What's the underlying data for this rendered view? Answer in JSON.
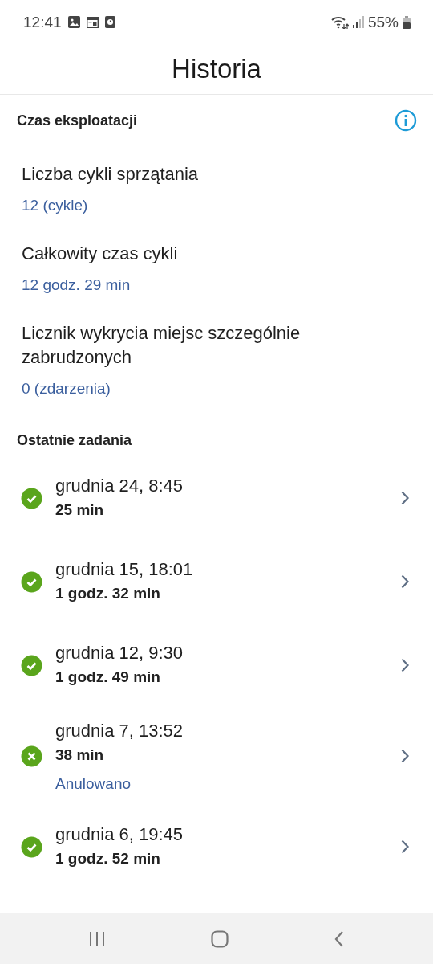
{
  "status_bar": {
    "time": "12:41",
    "battery": "55%"
  },
  "title": "Historia",
  "usage": {
    "heading": "Czas eksploatacji",
    "stats": [
      {
        "label": "Liczba cykli sprzątania",
        "value": "12 (cykle)"
      },
      {
        "label": "Całkowity czas cykli",
        "value": "12 godz. 29 min"
      },
      {
        "label": "Licznik wykrycia miejsc szczególnie zabrudzonych",
        "value": "0 (zdarzenia)"
      }
    ]
  },
  "recent": {
    "heading": "Ostatnie zadania",
    "tasks": [
      {
        "kind": "done",
        "date": "grudnia 24, 8:45",
        "duration": "25 min"
      },
      {
        "kind": "done",
        "date": "grudnia 15, 18:01",
        "duration": "1 godz. 32 min"
      },
      {
        "kind": "done",
        "date": "grudnia 12, 9:30",
        "duration": "1 godz. 49 min"
      },
      {
        "kind": "cancelled",
        "date": "grudnia 7, 13:52",
        "duration": "38 min",
        "note": "Anulowano"
      },
      {
        "kind": "done",
        "date": "grudnia 6, 19:45",
        "duration": "1 godz. 52 min"
      }
    ]
  }
}
